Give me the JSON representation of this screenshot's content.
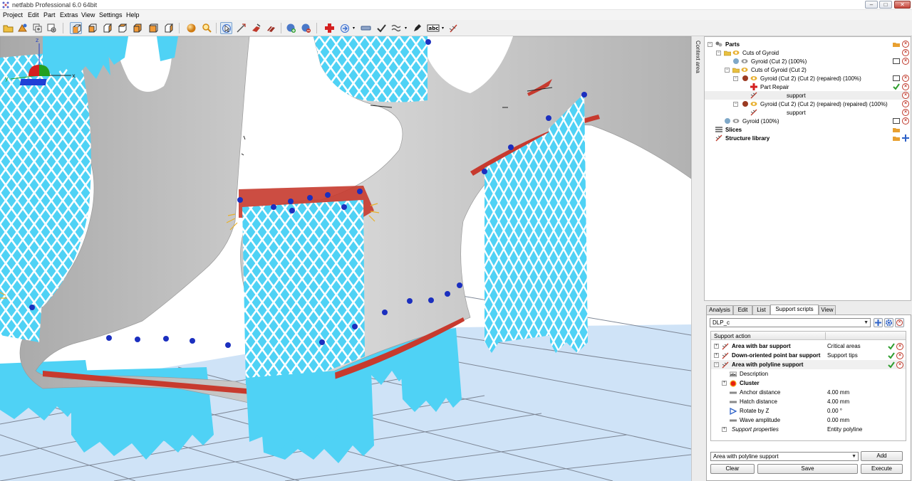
{
  "window": {
    "title": "netfabb Professional 6.0 64bit",
    "min": "–",
    "max": "□",
    "close": "✕"
  },
  "menu": [
    "Project",
    "Edit",
    "Part",
    "Extras",
    "View",
    "Settings",
    "Help"
  ],
  "context_area_label": "Context area",
  "tree": {
    "parts": "Parts",
    "cuts_of_gyroid": "Cuts of Gyroid",
    "gyroid_cut2": "Gyroid (Cut 2) (100%)",
    "cuts_of_gyroid_cut2": "Cuts of Gyroid (Cut 2)",
    "repaired": "Gyroid (Cut 2) (Cut 2) (repaired) (100%)",
    "part_repair": "Part Repair",
    "support1": "support",
    "repaired2": "Gyroid (Cut 2) (Cut 2) (repaired) (repaired) (100%)",
    "support2": "support",
    "gyroid": "Gyroid (100%)",
    "slices": "Slices",
    "structure_library": "Structure library"
  },
  "tabs": [
    "Analysis",
    "Edit",
    "List",
    "Support scripts",
    "View"
  ],
  "active_tab": "Support scripts",
  "script_select": "DLP_c",
  "actions_header": {
    "col1": "Support action",
    "col2": ""
  },
  "actions": {
    "bar": {
      "label": "Area with bar support",
      "value": "Critical areas"
    },
    "point": {
      "label": "Down-oriented point bar support",
      "value": "Support tips"
    },
    "polyline": {
      "label": "Area with polyline support",
      "value": ""
    },
    "description": {
      "label": "Description",
      "value": ""
    },
    "cluster": {
      "label": "Cluster",
      "value": ""
    },
    "anchor": {
      "label": "Anchor distance",
      "value": "4.00 mm"
    },
    "hatch": {
      "label": "Hatch distance",
      "value": "4.00 mm"
    },
    "rotate": {
      "label": "Rotate by Z",
      "value": "0.00 °"
    },
    "wave": {
      "label": "Wave amplitude",
      "value": "0.00 mm"
    },
    "support_props": {
      "label": "Support properties",
      "value": "Entity polyline"
    }
  },
  "bottom_select": "Area with polyline support",
  "buttons": {
    "add": "Add",
    "clear": "Clear",
    "save": "Save",
    "execute": "Execute"
  },
  "axes": {
    "x": "x",
    "y": "y",
    "z": "z"
  },
  "colors": {
    "support": "#4fd2f5",
    "model": "#bdbdbd",
    "build_plate": "#cfe3f7",
    "accent_red": "#c0392b",
    "ok_green": "#2e9e2e"
  }
}
